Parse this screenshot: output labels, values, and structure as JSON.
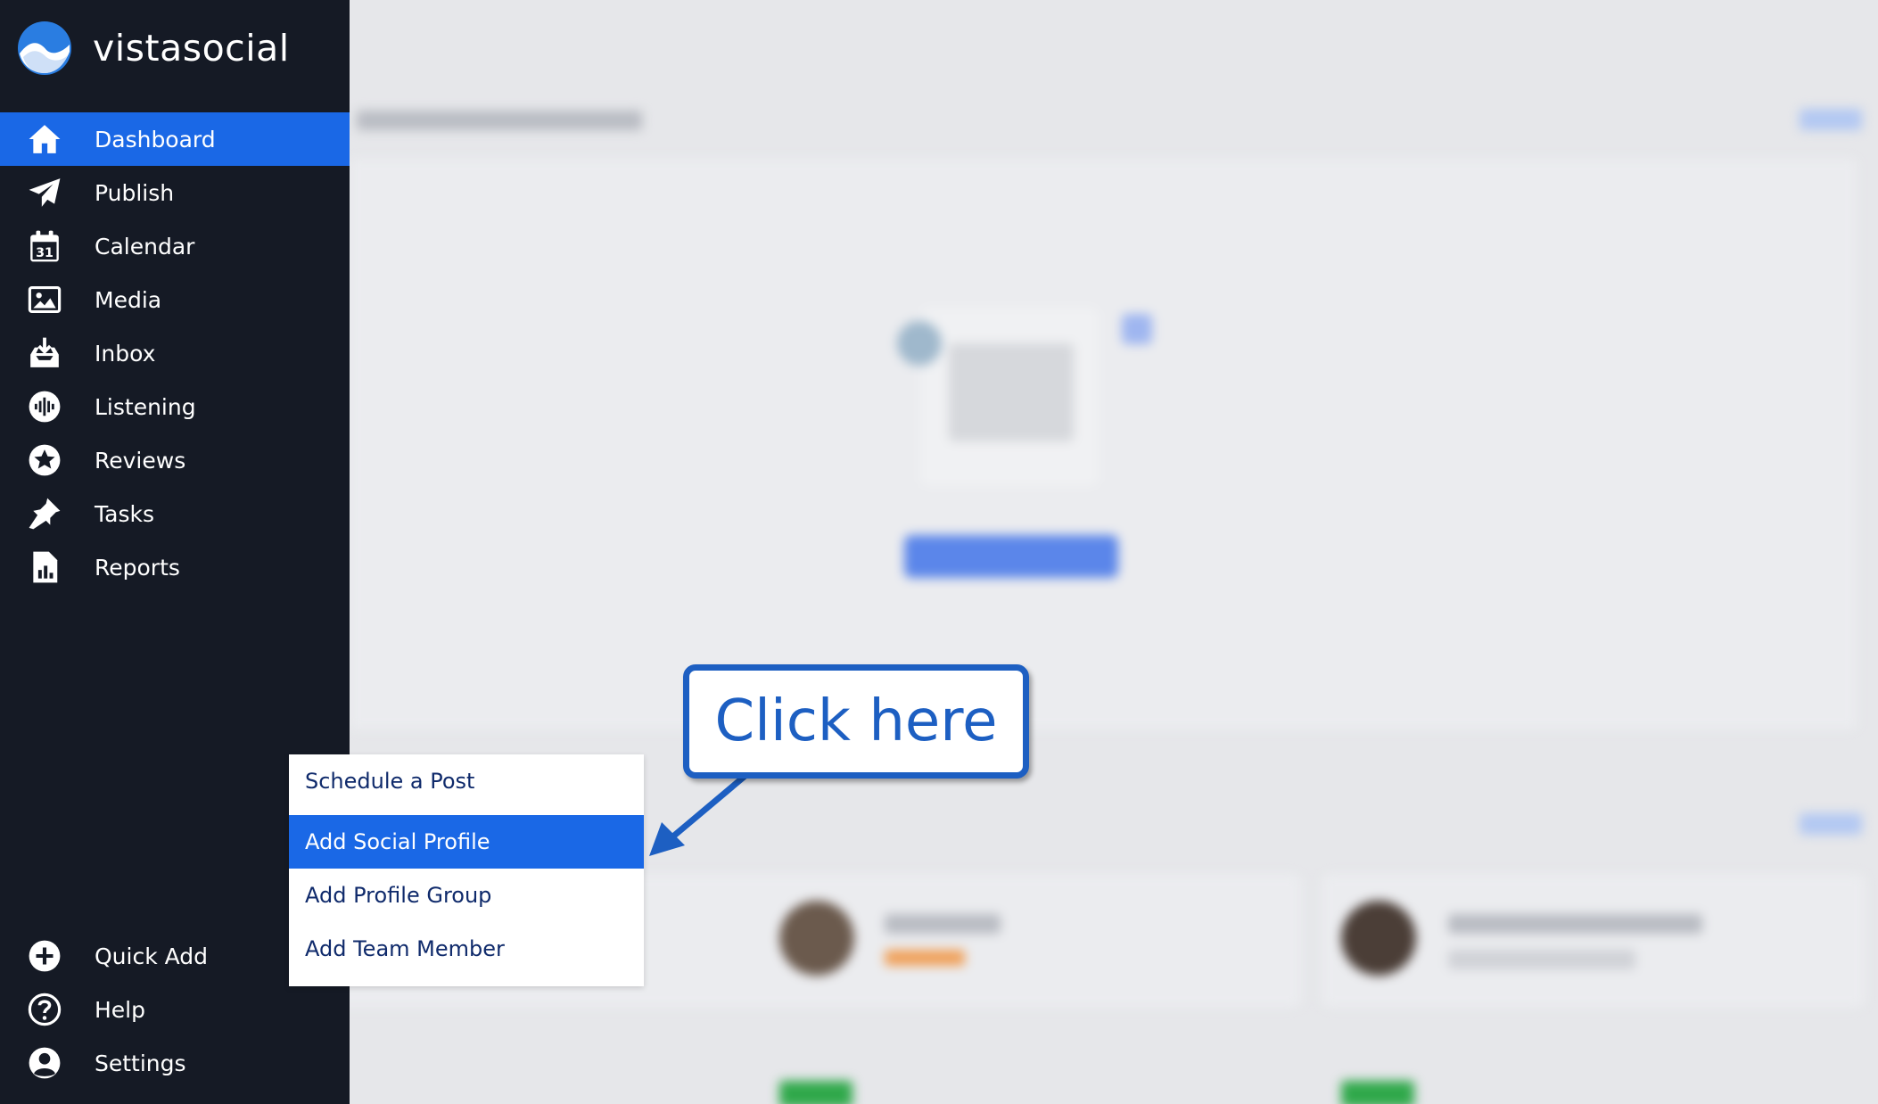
{
  "brand": {
    "name": "vistasocial"
  },
  "nav": {
    "items": [
      {
        "label": "Dashboard",
        "icon": "home-icon",
        "active": true
      },
      {
        "label": "Publish",
        "icon": "paper-plane-icon"
      },
      {
        "label": "Calendar",
        "icon": "calendar-icon"
      },
      {
        "label": "Media",
        "icon": "image-icon"
      },
      {
        "label": "Inbox",
        "icon": "inbox-icon"
      },
      {
        "label": "Listening",
        "icon": "listening-icon"
      },
      {
        "label": "Reviews",
        "icon": "star-icon"
      },
      {
        "label": "Tasks",
        "icon": "pin-icon"
      },
      {
        "label": "Reports",
        "icon": "report-icon"
      }
    ],
    "bottom": [
      {
        "label": "Quick Add",
        "icon": "plus-circle-icon"
      },
      {
        "label": "Help",
        "icon": "help-circle-icon"
      },
      {
        "label": "Settings",
        "icon": "user-circle-icon"
      }
    ]
  },
  "calendar_icon_day": "31",
  "quick_add_menu": {
    "items": [
      {
        "label": "Schedule a Post"
      },
      {
        "label": "Add Social Profile",
        "highlighted": true
      },
      {
        "label": "Add Profile Group"
      },
      {
        "label": "Add Team Member"
      }
    ]
  },
  "callout": {
    "text": "Click here"
  },
  "colors": {
    "sidebar": "#151a25",
    "accent": "#1a68e6",
    "callout": "#1d5fc2"
  }
}
